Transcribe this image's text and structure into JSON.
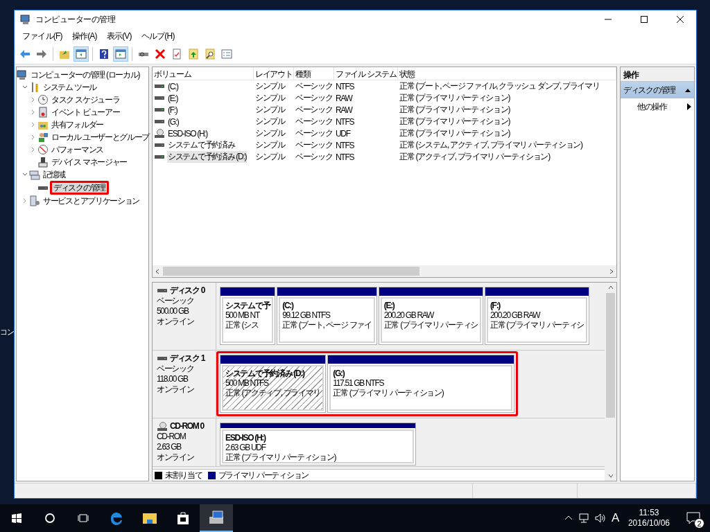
{
  "desktop_text": "コン",
  "window": {
    "title": "コンピューターの管理"
  },
  "menu": [
    "ファイル(F)",
    "操作(A)",
    "表示(V)",
    "ヘルプ(H)"
  ],
  "toolbar": [
    {
      "kind": "back",
      "selected": false
    },
    {
      "kind": "forward",
      "selected": false
    },
    {
      "kind": "sep"
    },
    {
      "kind": "up",
      "selected": false
    },
    {
      "kind": "tree",
      "selected": true
    },
    {
      "kind": "sep"
    },
    {
      "kind": "help",
      "selected": false
    },
    {
      "kind": "actionpane",
      "selected": true
    },
    {
      "kind": "sep"
    },
    {
      "kind": "connect",
      "selected": false
    },
    {
      "kind": "delete",
      "selected": false
    },
    {
      "kind": "properties",
      "selected": false
    },
    {
      "kind": "export",
      "selected": false
    },
    {
      "kind": "find",
      "selected": false
    },
    {
      "kind": "checklist",
      "selected": false
    }
  ],
  "tree": [
    {
      "label": "コンピューターの管理 (ローカル)",
      "kind": "computer",
      "selected": false,
      "children": [
        {
          "label": "システム ツール",
          "kind": "tools",
          "expanded": true,
          "selected": false,
          "children": [
            {
              "label": "タスク スケジューラ",
              "kind": "clock",
              "expanded": false,
              "selected": false
            },
            {
              "label": "イベント ビューアー",
              "kind": "event",
              "expanded": false,
              "selected": false
            },
            {
              "label": "共有フォルダー",
              "kind": "share",
              "expanded": false,
              "selected": false
            },
            {
              "label": "ローカル ユーザーとグループ",
              "kind": "users",
              "expanded": false,
              "selected": false
            },
            {
              "label": "パフォーマンス",
              "kind": "perf",
              "expanded": false,
              "selected": false
            },
            {
              "label": "デバイス マネージャー",
              "kind": "device",
              "selected": false
            }
          ]
        },
        {
          "label": "記憶域",
          "kind": "storage",
          "expanded": true,
          "selected": false,
          "children": [
            {
              "label": "ディスクの管理",
              "kind": "disk",
              "selected": true,
              "highlighted": true
            }
          ]
        },
        {
          "label": "サービスとアプリケーション",
          "kind": "services",
          "expanded": false,
          "selected": false
        }
      ]
    }
  ],
  "volumes": {
    "columns": [
      "ボリューム",
      "レイアウト",
      "種類",
      "ファイル システム",
      "状態"
    ],
    "rows": [
      {
        "kind": "disk",
        "selected": false,
        "cells": [
          "(C:)",
          "シンプル",
          "ベーシック",
          "NTFS",
          "正常 (ブート, ページ ファイル, クラッシュ ダンプ, プライマリ"
        ]
      },
      {
        "kind": "disk",
        "selected": false,
        "cells": [
          "(E:)",
          "シンプル",
          "ベーシック",
          "RAW",
          "正常 (プライマリ パーティション)"
        ]
      },
      {
        "kind": "disk",
        "selected": false,
        "cells": [
          "(F:)",
          "シンプル",
          "ベーシック",
          "RAW",
          "正常 (プライマリ パーティション)"
        ]
      },
      {
        "kind": "disk",
        "selected": false,
        "cells": [
          "(G:)",
          "シンプル",
          "ベーシック",
          "NTFS",
          "正常 (プライマリ パーティション)"
        ]
      },
      {
        "kind": "cdrom",
        "selected": false,
        "cells": [
          "ESD-ISO (H:)",
          "シンプル",
          "ベーシック",
          "UDF",
          "正常 (プライマリ パーティション)"
        ]
      },
      {
        "kind": "disk",
        "selected": false,
        "cells": [
          "システムで予約済み",
          "シンプル",
          "ベーシック",
          "NTFS",
          "正常 (システム, アクティブ, プライマリ パーティション)"
        ]
      },
      {
        "kind": "disk",
        "selected": true,
        "cells": [
          "システムで予約済み (D:)",
          "シンプル",
          "ベーシック",
          "NTFS",
          "正常 (アクティブ, プライマリ パーティション)"
        ]
      }
    ]
  },
  "disks": [
    {
      "kind": "disk",
      "name": "ディスク 0",
      "type": "ベーシック",
      "size": "500.00 GB",
      "status": "オンライン",
      "highlighted": false,
      "partitions": [
        {
          "kind": "primary",
          "selected": false,
          "name": "システムで予",
          "size": "500 MB NT",
          "status": "正常 (シス"
        },
        {
          "kind": "primary",
          "selected": false,
          "name": "(C:)",
          "size": "99.12 GB NTFS",
          "status": "正常 (ブート, ページ ファイ"
        },
        {
          "kind": "primary",
          "selected": false,
          "name": "(E:)",
          "size": "200.20 GB RAW",
          "status": "正常 (プライマリ パーティシ"
        },
        {
          "kind": "primary",
          "selected": false,
          "name": "(F:)",
          "size": "200.20 GB RAW",
          "status": "正常 (プライマリ パーティシ"
        }
      ]
    },
    {
      "kind": "disk",
      "name": "ディスク 1",
      "type": "ベーシック",
      "size": "118.00 GB",
      "status": "オンライン",
      "highlighted": true,
      "partitions": [
        {
          "kind": "primary",
          "selected": true,
          "name": "システムで予約済み  (D:)",
          "size": "500 MB NTFS",
          "status": "正常 (アクティブ, プライマリ"
        },
        {
          "kind": "primary",
          "selected": false,
          "name": "(G:)",
          "size": "117.51 GB NTFS",
          "status": "正常 (プライマリ パーティション)"
        }
      ]
    },
    {
      "kind": "cdrom",
      "name": "CD-ROM 0",
      "type": "CD-ROM",
      "size": "2.63 GB",
      "status": "オンライン",
      "highlighted": false,
      "partitions": [
        {
          "kind": "primary",
          "selected": false,
          "name": "ESD-ISO  (H:)",
          "size": "2.63 GB UDF",
          "status": "正常 (プライマリ パーティション)"
        }
      ]
    }
  ],
  "legend": [
    {
      "label": "未割り当て",
      "color": "#000000"
    },
    {
      "label": "プライマリ パーティション",
      "color": "#000080"
    }
  ],
  "actions": {
    "header": "操作",
    "sections": [
      {
        "title": "ディスクの管理",
        "expanded": true,
        "items": [
          {
            "label": "他の操作"
          }
        ]
      }
    ]
  },
  "taskbar": {
    "apps": [
      {
        "kind": "start",
        "selected": false
      },
      {
        "kind": "search",
        "selected": false
      },
      {
        "kind": "taskview",
        "selected": false
      },
      {
        "kind": "edge",
        "selected": false
      },
      {
        "kind": "explorer",
        "selected": false
      },
      {
        "kind": "store",
        "selected": false
      },
      {
        "kind": "compmgmt",
        "selected": true
      }
    ],
    "ime": "A",
    "time": "11:53",
    "date": "2016/10/06",
    "notifications": "2"
  }
}
